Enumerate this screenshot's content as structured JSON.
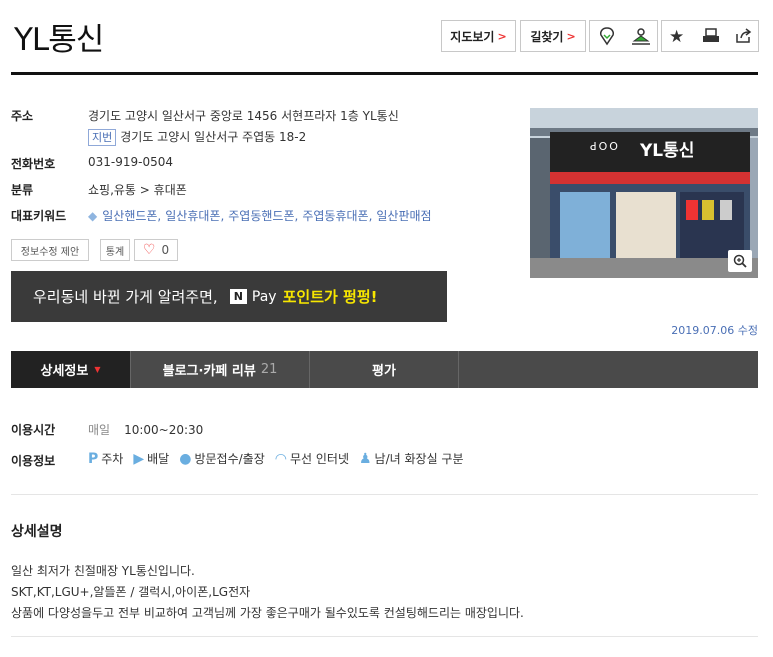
{
  "header": {
    "title": "YL통신",
    "map_button": "지도보기",
    "route_button": "길찾기",
    "arrow": ">"
  },
  "info": {
    "address_label": "주소",
    "address": "경기도 고양시 일산서구 중앙로 1456 서현프라자 1층 YL통신",
    "jibun_badge": "지번",
    "jibun_address": "경기도 고양시 일산서구 주엽동 18-2",
    "phone_label": "전화번호",
    "phone": "031-919-0504",
    "category_label": "분류",
    "category": "쇼핑,유통 > 휴대폰",
    "keywords_label": "대표키워드",
    "keywords": [
      "일산핸드폰,",
      "일산휴대폰,",
      "주엽동핸드폰,",
      "주엽동휴대폰,",
      "일산판매점"
    ]
  },
  "actions": {
    "suggest": "정보수정 제안",
    "stats": "통계",
    "likes": "0"
  },
  "banner": {
    "text": "우리동네 바뀐 가게 알려주면,",
    "npay_logo": "N",
    "pay": "Pay",
    "points": "포인트가 펑펑!"
  },
  "photo": {
    "sign_text": "YL통신",
    "sign_brand": "ꓒꓳꓳ"
  },
  "updated": "2019.07.06 수정",
  "tabs": [
    {
      "label": "상세정보",
      "marker": "▼"
    },
    {
      "label": "블로그·카페 리뷰",
      "count": "21"
    },
    {
      "label": "평가"
    }
  ],
  "hours": {
    "label": "이용시간",
    "day": "매일",
    "time": "10:00~20:30"
  },
  "amenities": {
    "label": "이용정보",
    "items": [
      "주차",
      "배달",
      "방문접수/출장",
      "무선 인터넷",
      "남/녀 화장실 구분"
    ]
  },
  "description": {
    "heading": "상세설명",
    "lines": [
      "일산 최저가 친절매장 YL통신입니다.",
      "SKT,KT,LGU+,알뜰폰 / 갤럭시,아이폰,LG전자",
      "상품에 다양성을두고 전부 비교하여 고객님께 가장 좋은구매가 될수있도록 컨설팅해드리는 매장입니다."
    ]
  },
  "colors": {
    "accent_red": "#e33333",
    "link_blue": "#4a6fb5",
    "tab_bg": "#4a4a4a",
    "npay_yellow": "#f7e600"
  }
}
